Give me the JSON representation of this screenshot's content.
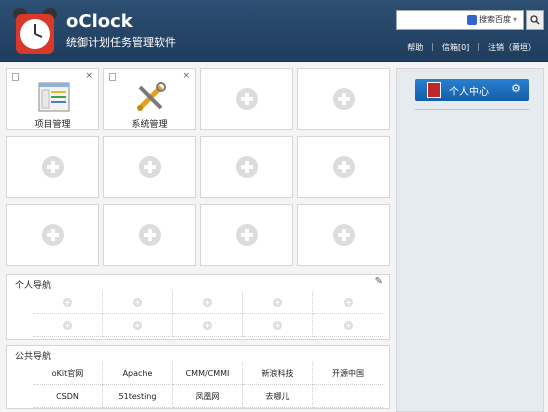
{
  "header": {
    "app_name": "oClock",
    "app_subtitle": "统御计划任务管理软件",
    "search": {
      "placeholder": "",
      "engine_label": "搜索百度"
    },
    "links": {
      "help": "帮助",
      "mailbox": "信箱[0]",
      "logout": "注销（萧垣）"
    }
  },
  "tiles": [
    {
      "label": "项目管理",
      "icon": "project-management-icon"
    },
    {
      "label": "系统管理",
      "icon": "system-management-icon"
    }
  ],
  "personal_nav": {
    "title": "个人导航"
  },
  "public_nav": {
    "title": "公共导航",
    "links": [
      "oKit官网",
      "Apache",
      "CMM/CMMI",
      "新浪科技",
      "开源中国",
      "CSDN",
      "51testing",
      "凤凰网",
      "去哪儿",
      ""
    ]
  },
  "user_center": {
    "label": "个人中心"
  },
  "colors": {
    "header": "#2d4f73",
    "accent_button": "#1e6fbf",
    "tile_bg": "#ffffff"
  }
}
